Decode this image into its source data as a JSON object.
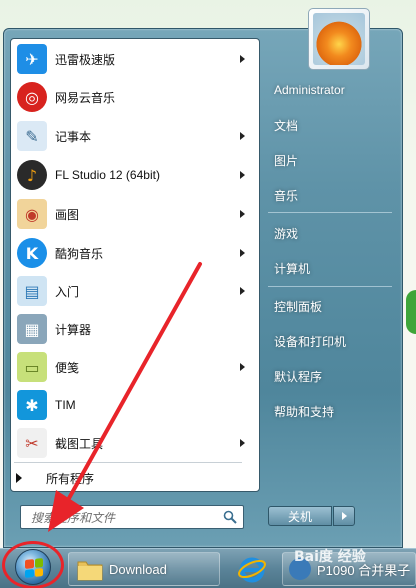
{
  "start_menu": {
    "programs": [
      {
        "label": "迅雷极速版",
        "icon": "xunlei-bird-icon",
        "has_arrow": true,
        "color": "#1e8ee6",
        "glyph": "✈"
      },
      {
        "label": "网易云音乐",
        "icon": "netease-music-icon",
        "has_arrow": false,
        "color": "#d8231e",
        "glyph": "◎"
      },
      {
        "label": "记事本",
        "icon": "notepad-icon",
        "has_arrow": true,
        "color": "#6aa8d8",
        "glyph": "✎"
      },
      {
        "label": "FL Studio 12 (64bit)",
        "icon": "fl-studio-icon",
        "has_arrow": true,
        "color": "#f2a010",
        "glyph": "♪"
      },
      {
        "label": "画图",
        "icon": "paint-palette-icon",
        "has_arrow": true,
        "color": "#e9c07a",
        "glyph": "🎨"
      },
      {
        "label": "酷狗音乐",
        "icon": "kugou-icon",
        "has_arrow": true,
        "color": "#1a8fe8",
        "glyph": "K"
      },
      {
        "label": "入门",
        "icon": "getting-started-icon",
        "has_arrow": true,
        "color": "#4fa3d6",
        "glyph": "▤"
      },
      {
        "label": "计算器",
        "icon": "calculator-icon",
        "has_arrow": false,
        "color": "#6f8fa6",
        "glyph": "▦"
      },
      {
        "label": "便笺",
        "icon": "sticky-notes-icon",
        "has_arrow": true,
        "color": "#b8d65a",
        "glyph": "▭"
      },
      {
        "label": "TIM",
        "icon": "tim-icon",
        "has_arrow": false,
        "color": "#1296db",
        "glyph": "✱"
      },
      {
        "label": "截图工具",
        "icon": "snipping-tool-icon",
        "has_arrow": true,
        "color": "#c0392b",
        "glyph": "✂"
      }
    ],
    "all_programs_label": "所有程序",
    "search_placeholder": "搜索程序和文件"
  },
  "right_pane": {
    "user": "Administrator",
    "group1": [
      "文档",
      "图片",
      "音乐"
    ],
    "group2": [
      "游戏",
      "计算机"
    ],
    "group3": [
      "控制面板",
      "设备和打印机",
      "默认程序",
      "帮助和支持"
    ],
    "shutdown_label": "关机"
  },
  "taskbar": {
    "download_label": "Download",
    "watermark": "Bai度 经验",
    "window_partial_label": "P1090 合并果子"
  }
}
